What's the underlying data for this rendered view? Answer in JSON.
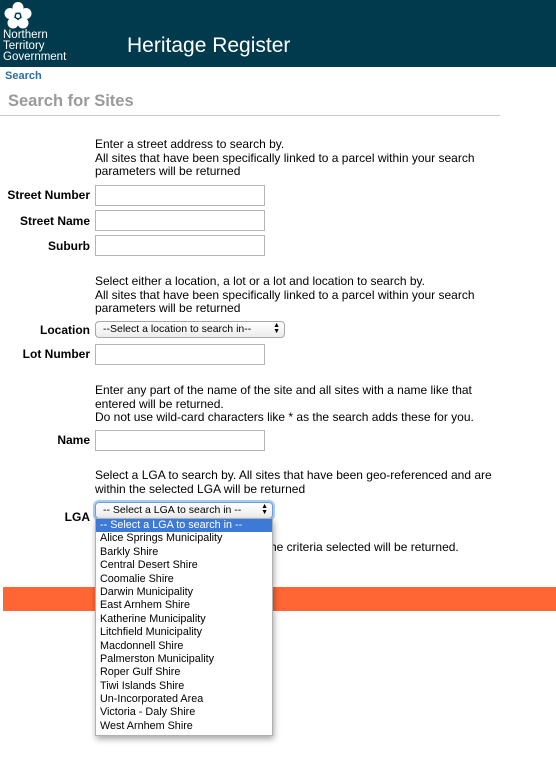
{
  "header": {
    "logo_lines": [
      "Northern",
      "Territory",
      "Government"
    ],
    "title": "Heritage Register"
  },
  "breadcrumb": "Search",
  "page_title": "Search for Sites",
  "street_section": {
    "instruction_1": "Enter a street address to search by.",
    "instruction_2": "All sites that have been specifically linked to a parcel within your search parameters will be returned",
    "street_number_label": "Street Number",
    "street_number_value": "",
    "street_name_label": "Street Name",
    "street_name_value": "",
    "suburb_label": "Suburb",
    "suburb_value": ""
  },
  "location_section": {
    "instruction_1": "Select either a location, a lot or a lot and location to search by.",
    "instruction_2": "All sites that have been specifically linked to a parcel within your search parameters will be returned",
    "location_label": "Location",
    "location_selected": "--Select a location to search in--",
    "lot_number_label": "Lot Number",
    "lot_number_value": ""
  },
  "name_section": {
    "instruction_1": "Enter any part of the name of the site and all sites with a name like that entered will be returned.",
    "instruction_2": "Do not use wild-card characters like * as the search adds these for you.",
    "name_label": "Name",
    "name_value": ""
  },
  "lga_section": {
    "instruction": "Select a LGA to search by. All sites that have been geo-referenced and are within the selected LGA will be returned",
    "lga_label": "LGA",
    "lga_selected": "-- Select a LGA to search in --",
    "trailing_text": "he criteria selected will be returned.",
    "options": [
      "-- Select a LGA to search in --",
      "Alice Springs Municipality",
      "Barkly Shire",
      "Central Desert Shire",
      "Coomalie Shire",
      "Darwin Municipality",
      "East Arnhem Shire",
      "Katherine Municipality",
      "Litchfield Municipality",
      "Macdonnell Shire",
      "Palmerston Municipality",
      "Roper Gulf Shire",
      "Tiwi Islands Shire",
      "Un-Incorporated Area",
      "Victoria - Daly Shire",
      "West Arnhem Shire"
    ]
  },
  "colors": {
    "header_bg": "#003a4c",
    "accent_orange": "#ff6633",
    "dropdown_highlight": "#3d7ad8",
    "link_blue": "#2a6f9c"
  },
  "icons": {
    "logo": "nt-flower-logo-icon",
    "select_arrows": "up-down-arrows-icon"
  }
}
